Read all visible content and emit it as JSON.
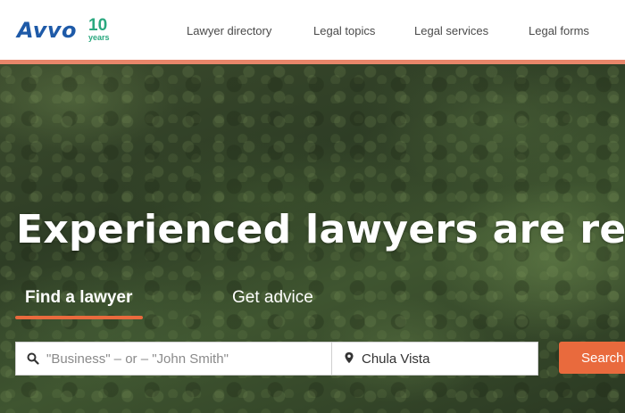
{
  "brand": {
    "logo_text": "Avvo",
    "anniversary_number": "10",
    "anniversary_label": "years",
    "logo_color": "#1e5aa8",
    "anniversary_color": "#2aa87f"
  },
  "nav": {
    "items": [
      {
        "label": "Lawyer directory"
      },
      {
        "label": "Legal topics"
      },
      {
        "label": "Legal services"
      },
      {
        "label": "Legal forms"
      }
    ]
  },
  "hero": {
    "headline": "Experienced lawyers are ready"
  },
  "tabs": {
    "items": [
      {
        "label": "Find a lawyer",
        "active": true
      },
      {
        "label": "Get advice",
        "active": false
      }
    ]
  },
  "search": {
    "keyword_placeholder": "\"Business\" – or – \"John Smith\"",
    "keyword_value": "",
    "location_value": "Chula Vista",
    "button_label": "Search",
    "icons": [
      "search-icon",
      "map-pin-icon"
    ]
  },
  "colors": {
    "accent": "#e96a3d",
    "header_border": "#e8866a"
  }
}
